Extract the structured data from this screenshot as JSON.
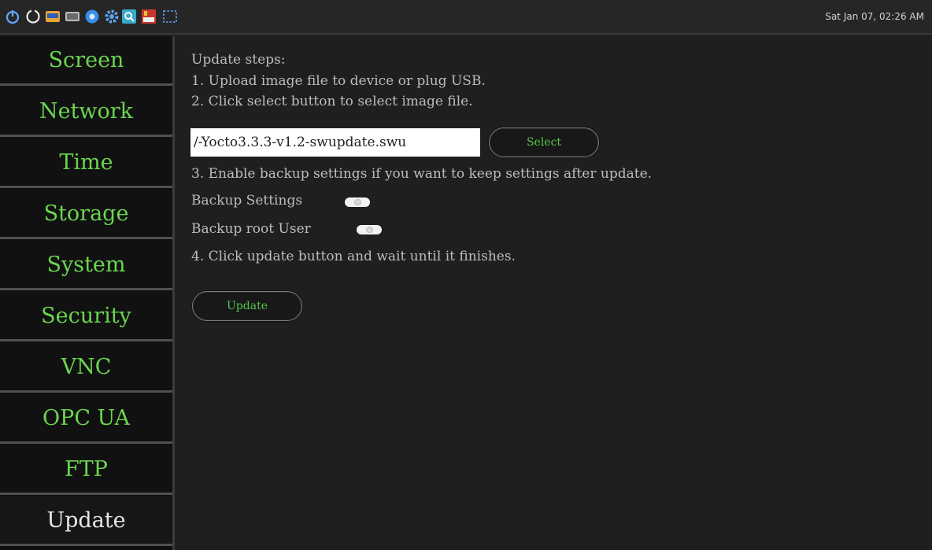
{
  "taskbar": {
    "icons": [
      "power-icon",
      "restart-icon",
      "panel-app-icon",
      "keyboard-icon",
      "browser-icon",
      "settings-gear-icon",
      "search-app-icon",
      "vnc-icon",
      "screenshot-selection-icon"
    ],
    "clock": "Sat Jan 07, 02:26 AM"
  },
  "sidebar": {
    "items": [
      {
        "label": "Screen"
      },
      {
        "label": "Network"
      },
      {
        "label": "Time"
      },
      {
        "label": "Storage"
      },
      {
        "label": "System"
      },
      {
        "label": "Security"
      },
      {
        "label": "VNC"
      },
      {
        "label": "OPC UA"
      },
      {
        "label": "FTP"
      },
      {
        "label": "Update"
      }
    ],
    "active": "Update"
  },
  "main": {
    "heading": "Update steps:",
    "step1": "1. Upload image file to device or plug USB.",
    "step2": "2. Click select button to select image file.",
    "file_path": "/-Yocto3.3.3-v1.2-swupdate.swu",
    "select_label": "Select",
    "step3": "3. Enable backup settings if you want to keep settings after update.",
    "backup_settings_label": "Backup Settings",
    "backup_root_label": "Backup root User",
    "step4": "4. Click update button and wait until it finishes.",
    "update_label": "Update"
  },
  "colors": {
    "accent_green": "#6ad64f",
    "background": "#1f1f1f",
    "sidebar_bg": "#0f0f0f"
  }
}
